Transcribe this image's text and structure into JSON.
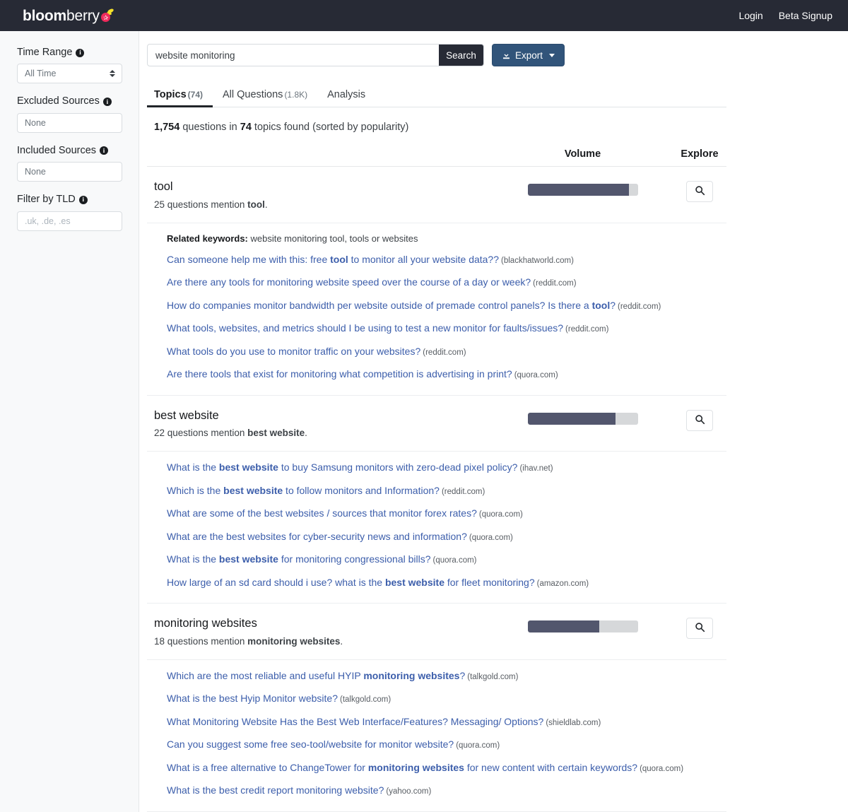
{
  "brand": {
    "name_bold": "bloom",
    "name_light": "berry",
    "berry_color": "#ef2a5b",
    "leaf_color": "#f4e12a"
  },
  "topnav": {
    "login_label": "Login",
    "beta_label": "Beta Signup",
    "background": "#272a35"
  },
  "sidebar": {
    "fields": [
      {
        "label": "Time Range",
        "info": "i",
        "control": "select",
        "value": "All Time"
      },
      {
        "label": "Excluded Sources",
        "info": "i",
        "control": "text",
        "value": "None"
      },
      {
        "label": "Included Sources",
        "info": "i",
        "control": "text",
        "value": "None"
      },
      {
        "label": "Filter by TLD",
        "info": "i",
        "control": "text",
        "value": "",
        "placeholder": ".uk, .de, .es"
      }
    ]
  },
  "search": {
    "value": "website monitoring",
    "placeholder": "website monitoring",
    "search_label": "Search",
    "export_label": "Export",
    "export_icon": "download-icon",
    "search_button_color": "#272a35",
    "export_button_color": "#31547a"
  },
  "tabs": [
    {
      "label": "Topics",
      "count": "(74)",
      "active": true
    },
    {
      "label": "All Questions",
      "count": "(1.8K)",
      "active": false
    },
    {
      "label": "Analysis",
      "count": "",
      "active": false
    }
  ],
  "summary": {
    "questions_count": "1,754",
    "mid_text": " questions in ",
    "topics_count": "74",
    "tail_text": " topics found (sorted by popularity)"
  },
  "table_headers": {
    "volume": "Volume",
    "explore": "Explore"
  },
  "topics": [
    {
      "name": "tool",
      "count_text": "25",
      "mention_text": " questions mention ",
      "mention_term": "tool",
      "period": ".",
      "volume_percent": 92,
      "explore_icon": "search-icon",
      "related_keywords_label": "Related keywords:",
      "related_keywords": " website monitoring tool, tools or websites",
      "questions": [
        {
          "pre": "Can someone help me with this: free ",
          "bold": "tool",
          "post": " to monitor all your website data??",
          "source": "(blackhatworld.com)"
        },
        {
          "pre": "Are there any tools for monitoring website speed over the course of a day or week?",
          "bold": "",
          "post": "",
          "source": "(reddit.com)"
        },
        {
          "pre": "How do companies monitor bandwidth per website outside of premade control panels? Is there a ",
          "bold": "tool",
          "post": "?",
          "source": "(reddit.com)"
        },
        {
          "pre": "What tools, websites, and metrics should I be using to test a new monitor for faults/issues?",
          "bold": "",
          "post": "",
          "source": "(reddit.com)"
        },
        {
          "pre": "What tools do you use to monitor traffic on your websites?",
          "bold": "",
          "post": "",
          "source": "(reddit.com)"
        },
        {
          "pre": "Are there tools that exist for monitoring what competition is advertising in print?",
          "bold": "",
          "post": "",
          "source": "(quora.com)"
        }
      ]
    },
    {
      "name": "best website",
      "count_text": "22",
      "mention_text": " questions mention ",
      "mention_term": "best website",
      "period": ".",
      "volume_percent": 80,
      "explore_icon": "search-icon",
      "related_keywords_label": "",
      "related_keywords": "",
      "questions": [
        {
          "pre": "What is the ",
          "bold": "best website",
          "post": " to buy Samsung monitors with zero-dead pixel policy?",
          "source": "(ihav.net)"
        },
        {
          "pre": "Which is the ",
          "bold": "best website",
          "post": " to follow monitors and Information?",
          "source": "(reddit.com)"
        },
        {
          "pre": "What are some of the best websites / sources that monitor forex rates?",
          "bold": "",
          "post": "",
          "source": "(quora.com)"
        },
        {
          "pre": "What are the best websites for cyber-security news and information?",
          "bold": "",
          "post": "",
          "source": "(quora.com)"
        },
        {
          "pre": "What is the ",
          "bold": "best website",
          "post": " for monitoring congressional bills?",
          "source": "(quora.com)"
        },
        {
          "pre": "How large of an sd card should i use? what is the ",
          "bold": "best website",
          "post": " for fleet monitoring?",
          "source": "(amazon.com)"
        }
      ]
    },
    {
      "name": "monitoring websites",
      "count_text": "18",
      "mention_text": " questions mention ",
      "mention_term": "monitoring websites",
      "period": ".",
      "volume_percent": 65,
      "explore_icon": "search-icon",
      "related_keywords_label": "",
      "related_keywords": "",
      "questions": [
        {
          "pre": "Which are the most reliable and useful HYIP ",
          "bold": "monitoring websites",
          "post": "?",
          "source": "(talkgold.com)"
        },
        {
          "pre": "What is the best Hyip Monitor website?",
          "bold": "",
          "post": "",
          "source": "(talkgold.com)"
        },
        {
          "pre": "What Monitoring Website Has the Best Web Interface/Features? Messaging/ Options?",
          "bold": "",
          "post": "",
          "source": "(shieldlab.com)"
        },
        {
          "pre": "Can you suggest some free seo-tool/website for monitor website?",
          "bold": "",
          "post": "",
          "source": "(quora.com)"
        },
        {
          "pre": "What is a free alternative to ChangeTower for ",
          "bold": "monitoring websites",
          "post": " for new content with certain keywords?",
          "source": "(quora.com)"
        },
        {
          "pre": "What is the best credit report monitoring website?",
          "bold": "",
          "post": "",
          "source": "(yahoo.com)"
        }
      ]
    }
  ]
}
